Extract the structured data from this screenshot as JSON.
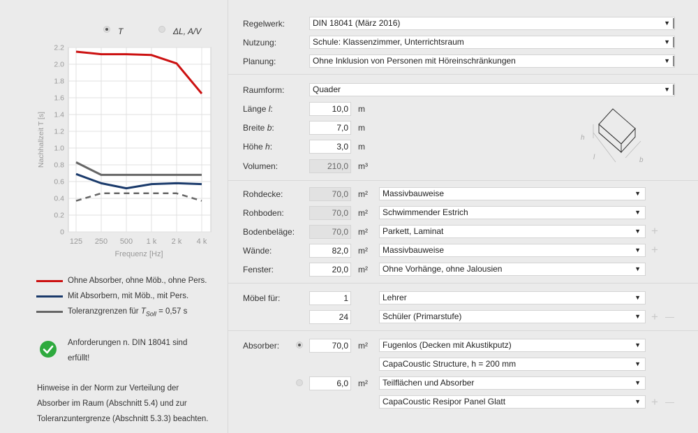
{
  "chart": {
    "legend_top": [
      {
        "label": "T",
        "selected": true
      },
      {
        "label": "ΔL, A/V",
        "selected": false
      }
    ],
    "ylabel": "Nachhallzeit T [s]",
    "xlabel": "Frequenz [Hz]",
    "y_ticks": [
      "2.2",
      "2.0",
      "1.8",
      "1.6",
      "1.4",
      "1.2",
      "1.0",
      "0.8",
      "0.6",
      "0.4",
      "0.2",
      "0"
    ],
    "x_ticks": [
      "125",
      "250",
      "500",
      "1 k",
      "2 k",
      "4 k"
    ]
  },
  "chart_data": {
    "type": "line",
    "x": [
      "125",
      "250",
      "500",
      "1 k",
      "2 k",
      "4 k"
    ],
    "ylim": [
      0,
      2.2
    ],
    "grid": true,
    "series": [
      {
        "name": "Ohne Absorber, ohne Möb., ohne Pers.",
        "color": "#cc1111",
        "values": [
          2.15,
          2.12,
          2.12,
          2.11,
          2.01,
          1.65
        ]
      },
      {
        "name": "Mit Absorbern, mit Möb., mit Pers.",
        "color": "#1a3a6b",
        "values": [
          0.69,
          0.58,
          0.52,
          0.57,
          0.58,
          0.57
        ]
      },
      {
        "name": "Toleranzgrenzen für T_Soll = 0,57 s",
        "color": "#666666",
        "values": [
          0.83,
          0.68,
          0.68,
          0.68,
          0.68,
          0.68
        ]
      },
      {
        "name": "Toleranzuntergrenze",
        "color": "#666666",
        "dashed": true,
        "values": [
          0.37,
          0.46,
          0.46,
          0.46,
          0.46,
          0.37
        ]
      }
    ]
  },
  "legend": [
    {
      "text": "Ohne Absorber, ohne Möb., ohne Pers.",
      "color": "#cc1111"
    },
    {
      "text": "Mit Absorbern, mit Möb., mit Pers.",
      "color": "#1a3a6b"
    },
    {
      "text_pre": "Toleranzgrenzen für ",
      "text_var": "T",
      "text_sub": "Soll",
      "text_post": " = 0,57 s",
      "color": "#666666"
    }
  ],
  "status": {
    "line1": "Anforderungen n. DIN 18041 sind",
    "line2": "erfüllt!"
  },
  "hint": {
    "line1": "Hinweise in der Norm zur Verteilung der",
    "line2": "Absorber im Raum (Abschnitt 5.4) und zur",
    "line3": "Toleranzuntergrenze (Abschnitt 5.3.3) beachten."
  },
  "form": {
    "regelwerk": {
      "label": "Regelwerk:",
      "value": "DIN 18041 (März 2016)"
    },
    "nutzung": {
      "label": "Nutzung:",
      "value": "Schule: Klassenzimmer, Unterrichtsraum"
    },
    "planung": {
      "label": "Planung:",
      "value": "Ohne Inklusion von Personen mit Höreinschränkungen"
    },
    "raumform": {
      "label": "Raumform:",
      "value": "Quader"
    },
    "laenge": {
      "label": "Länge",
      "var": "l",
      "value": "10,0",
      "unit": "m"
    },
    "breite": {
      "label": "Breite",
      "var": "b",
      "value": "7,0",
      "unit": "m"
    },
    "hoehe": {
      "label": "Höhe",
      "var": "h",
      "value": "3,0",
      "unit": "m"
    },
    "volumen": {
      "label": "Volumen:",
      "value": "210,0",
      "unit": "m³"
    },
    "surfaces": [
      {
        "label": "Rohdecke:",
        "value": "70,0",
        "unit": "m²",
        "material": "Massivbauweise",
        "readonly": true
      },
      {
        "label": "Rohboden:",
        "value": "70,0",
        "unit": "m²",
        "material": "Schwimmender Estrich",
        "readonly": true
      },
      {
        "label": "Bodenbeläge:",
        "value": "70,0",
        "unit": "m²",
        "material": "Parkett, Laminat",
        "readonly": true
      },
      {
        "label": "Wände:",
        "value": "82,0",
        "unit": "m²",
        "material": "Massivbauweise",
        "readonly": false
      },
      {
        "label": "Fenster:",
        "value": "20,0",
        "unit": "m²",
        "material": "Ohne Vorhänge, ohne Jalousien",
        "readonly": false
      }
    ],
    "moebel": {
      "label": "Möbel für:",
      "rows": [
        {
          "count": "1",
          "value": "Lehrer"
        },
        {
          "count": "24",
          "value": "Schüler (Primarstufe)"
        }
      ]
    },
    "absorber": {
      "label": "Absorber:",
      "groups": [
        {
          "selected": true,
          "value": "70,0",
          "unit": "m²",
          "type": "Fugenlos (Decken mit Akustikputz)",
          "product": "CapaCoustic Structure, h = 200 mm"
        },
        {
          "selected": false,
          "value": "6,0",
          "unit": "m²",
          "type": "Teilflächen und Absorber",
          "product": "CapaCoustic Resipor Panel Glatt"
        }
      ]
    },
    "room_diagram": {
      "h": "h",
      "l": "l",
      "b": "b"
    }
  },
  "icons": {
    "plus": "+",
    "minus": "—",
    "arrow": "▼"
  }
}
